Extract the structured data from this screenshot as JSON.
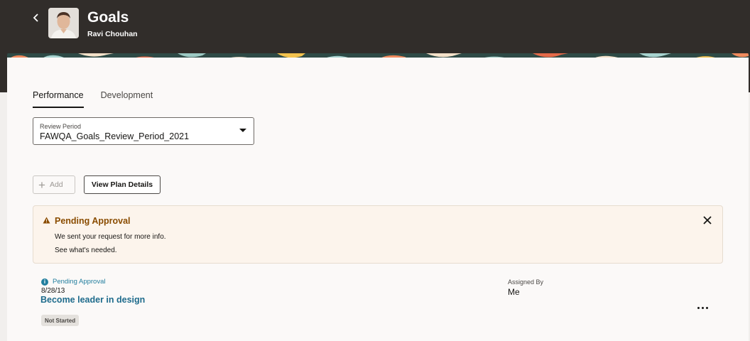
{
  "header": {
    "title": "Goals",
    "subtitle": "Ravi Chouhan"
  },
  "tabs": [
    {
      "label": "Performance",
      "active": true
    },
    {
      "label": "Development",
      "active": false
    }
  ],
  "review_period": {
    "label": "Review Period",
    "value": "FAWQA_Goals_Review_Period_2021"
  },
  "actions": {
    "add_label": "Add",
    "view_plan_label": "View Plan Details"
  },
  "alert": {
    "title": "Pending Approval",
    "line1": "We sent your request for more info.",
    "line2": "See what's needed."
  },
  "goal": {
    "status": "Pending Approval",
    "date": "8/28/13",
    "title": "Become leader in design",
    "badge": "Not Started",
    "assigned_by_label": "Assigned By",
    "assigned_by_value": "Me"
  },
  "colors": {
    "header_bg": "#312d2a",
    "link": "#1e6b8c",
    "warning": "#8a4c00",
    "alert_bg": "#fcf4ec"
  }
}
